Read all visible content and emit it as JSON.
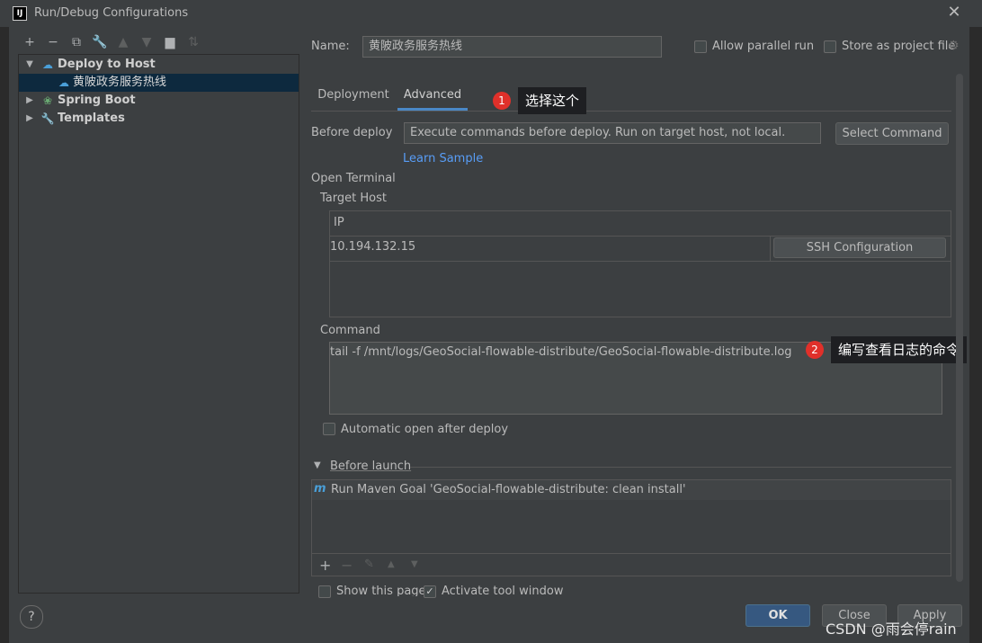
{
  "window": {
    "title": "Run/Debug Configurations"
  },
  "toolbar": {
    "icons": [
      "add-icon",
      "remove-icon",
      "copy-icon",
      "wrench-icon",
      "move-up-icon",
      "move-down-icon",
      "folder-icon",
      "sort-icon"
    ]
  },
  "tree": {
    "items": [
      {
        "label": "Deploy to Host",
        "bold": true
      },
      {
        "label": "黄陂政务服务热线",
        "selected": true
      },
      {
        "label": "Spring Boot",
        "bold": true
      },
      {
        "label": "Templates",
        "bold": true
      }
    ]
  },
  "header": {
    "name_label": "Name:",
    "name_value": "黄陂政务服务热线",
    "allow_parallel": "Allow parallel run",
    "store_project": "Store as project file"
  },
  "tabs": [
    {
      "label": "Deployment"
    },
    {
      "label": "Advanced",
      "active": true
    }
  ],
  "annotations": {
    "a1": {
      "num": "1",
      "text": "选择这个"
    },
    "a2": {
      "num": "2",
      "text": "编写查看日志的命令"
    }
  },
  "before_deploy": {
    "label": "Before deploy",
    "value": "Execute commands before deploy. Run on target host, not local.",
    "button": "Select Command",
    "link": "Learn Sample"
  },
  "terminal": {
    "open_terminal": "Open Terminal",
    "target_host": "Target Host",
    "ip_header": "IP",
    "ip_value": "10.194.132.15",
    "ssh_button": "SSH Configuration",
    "command_label": "Command",
    "command_value": "tail -f /mnt/logs/GeoSocial-flowable-distribute/GeoSocial-flowable-distribute.log",
    "auto_open": "Automatic open after deploy"
  },
  "before_launch": {
    "label": "Before launch",
    "item": "Run Maven Goal 'GeoSocial-flowable-distribute: clean install'"
  },
  "footer": {
    "show_page": "Show this page",
    "activate_tool": "Activate tool window",
    "ok": "OK",
    "close": "Close",
    "apply": "Apply",
    "help": "?"
  },
  "watermark": "CSDN @雨会停rain",
  "colors": {
    "accent": "#4a88c7",
    "primary_button": "#365880",
    "badge": "#e0302a",
    "link": "#589df6"
  }
}
